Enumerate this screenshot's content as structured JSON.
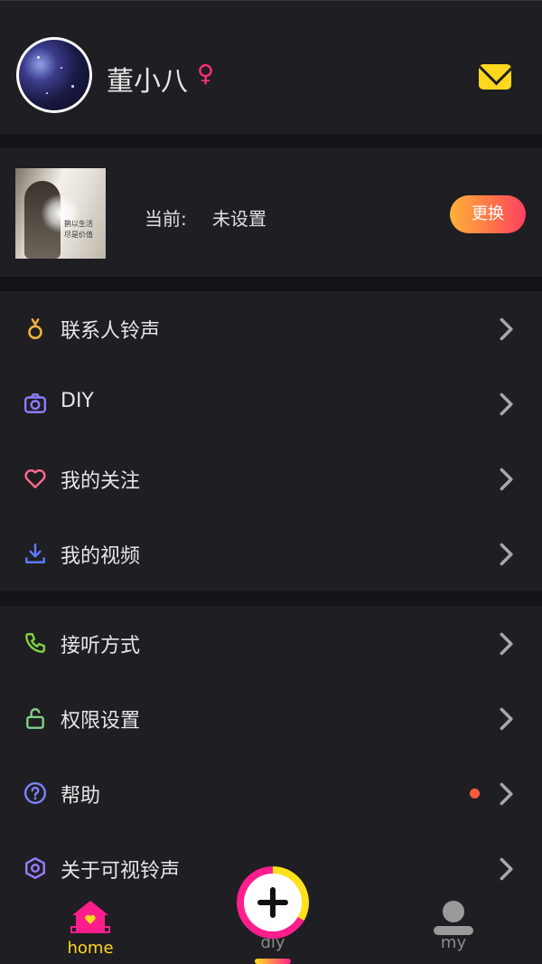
{
  "profile": {
    "username": "董小八",
    "gender_symbol": "♀",
    "mail_icon": "mail-icon"
  },
  "ringtone": {
    "cover_caption_line1": "鹊以生活",
    "cover_caption_line2": "尽是价值",
    "current_label": "当前:",
    "current_value": "未设置",
    "change_button": "更换"
  },
  "menu_group1": [
    {
      "label": "联系人铃声",
      "icon": "music-note-icon",
      "color": "#f0b23a"
    },
    {
      "label": "DIY",
      "icon": "camera-icon",
      "color": "#8b7dff"
    },
    {
      "label": "我的关注",
      "icon": "heart-icon",
      "color": "#ff6b8b"
    },
    {
      "label": "我的视频",
      "icon": "download-icon",
      "color": "#5d7cff"
    }
  ],
  "menu_group2": [
    {
      "label": "接听方式",
      "icon": "phone-icon",
      "color": "#7fd23f"
    },
    {
      "label": "权限设置",
      "icon": "unlock-icon",
      "color": "#7fcf86"
    },
    {
      "label": "帮助",
      "icon": "help-icon",
      "color": "#7d83ff",
      "has_dot": true
    },
    {
      "label": "关于可视铃声",
      "icon": "hexagon-icon",
      "color": "#9a7dff"
    }
  ],
  "tabbar": {
    "home": "home",
    "diy": "diy",
    "my": "my",
    "active_color": "#ffd71f",
    "inactive_color": "#8a8a8a"
  }
}
